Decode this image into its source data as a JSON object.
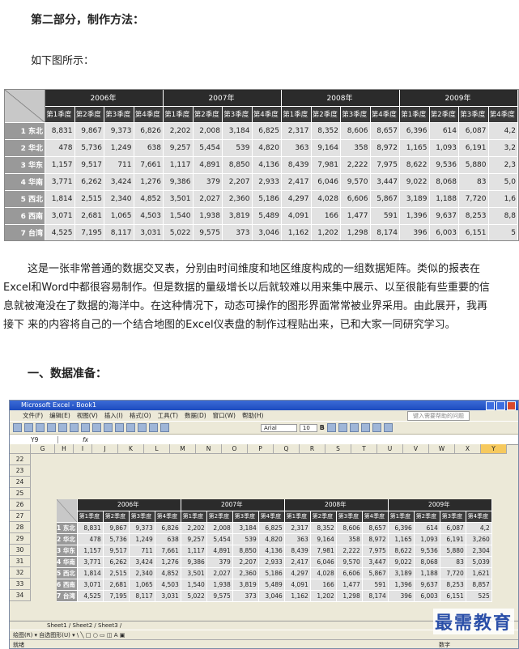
{
  "section_title": "第二部分，制作方法：",
  "intro": "如下图所示：",
  "table": {
    "years": [
      "2006年",
      "2007年",
      "2008年",
      "2009年"
    ],
    "quarters": [
      "第1季度",
      "第2季度",
      "第3季度",
      "第4季度"
    ],
    "rows": [
      {
        "label": "1 东北",
        "values": [
          "8,831",
          "9,867",
          "9,373",
          "6,826",
          "2,202",
          "2,008",
          "3,184",
          "6,825",
          "2,317",
          "8,352",
          "8,606",
          "8,657",
          "6,396",
          "614",
          "6,087",
          "4,2"
        ]
      },
      {
        "label": "2 华北",
        "values": [
          "478",
          "5,736",
          "1,249",
          "638",
          "9,257",
          "5,454",
          "539",
          "4,820",
          "363",
          "9,164",
          "358",
          "8,972",
          "1,165",
          "1,093",
          "6,191",
          "3,2"
        ]
      },
      {
        "label": "3 华东",
        "values": [
          "1,157",
          "9,517",
          "711",
          "7,661",
          "1,117",
          "4,891",
          "8,850",
          "4,136",
          "8,439",
          "7,981",
          "2,222",
          "7,975",
          "8,622",
          "9,536",
          "5,880",
          "2,3"
        ]
      },
      {
        "label": "4 华南",
        "values": [
          "3,771",
          "6,262",
          "3,424",
          "1,276",
          "9,386",
          "379",
          "2,207",
          "2,933",
          "2,417",
          "6,046",
          "9,570",
          "3,447",
          "9,022",
          "8,068",
          "83",
          "5,0"
        ]
      },
      {
        "label": "5 西北",
        "values": [
          "1,814",
          "2,515",
          "2,340",
          "4,852",
          "3,501",
          "2,027",
          "2,360",
          "5,186",
          "4,297",
          "4,028",
          "6,606",
          "5,867",
          "3,189",
          "1,188",
          "7,720",
          "1,6"
        ]
      },
      {
        "label": "6 西南",
        "values": [
          "3,071",
          "2,681",
          "1,065",
          "4,503",
          "1,540",
          "1,938",
          "3,819",
          "5,489",
          "4,091",
          "166",
          "1,477",
          "591",
          "1,396",
          "9,637",
          "8,253",
          "8,8"
        ]
      },
      {
        "label": "7 台湾",
        "values": [
          "4,525",
          "7,195",
          "8,117",
          "3,031",
          "5,022",
          "9,575",
          "373",
          "3,046",
          "1,162",
          "1,202",
          "1,298",
          "8,174",
          "396",
          "6,003",
          "6,151",
          "5"
        ]
      }
    ]
  },
  "paragraph_lines": [
    "这是一张非常普通的数据交叉表，分别由时间维度和地区维度构成的一组数据矩阵。类似的报表在",
    "Excel和Word中都很容易制作。但是数据的量级增长以后就较难以用来集中展示、以至很能有些重要的信",
    "息就被淹没在了数据的海洋中。在这种情况下，动态可操作的图形界面常常被业界采用。由此展开，我再",
    "接下 来的内容将自己的一个结合地图的Excel仪表盘的制作过程贴出来，已和大家一同研究学习。"
  ],
  "section2_title": "一、数据准备：",
  "excel": {
    "title": "Microsoft Excel - Book1",
    "menu": [
      "文件(F)",
      "编辑(E)",
      "视图(V)",
      "插入(I)",
      "格式(O)",
      "工具(T)",
      "数据(D)",
      "窗口(W)",
      "帮助(H)"
    ],
    "help_box": "键入需要帮助的问题",
    "font_name": "Arial",
    "font_size": "10",
    "name_box": "Y9",
    "fx": "fx",
    "columns": [
      "G",
      "H",
      "I",
      "J",
      "K",
      "L",
      "M",
      "N",
      "O",
      "P",
      "Q",
      "R",
      "S",
      "T",
      "U",
      "V",
      "W",
      "X",
      "Y"
    ],
    "row_numbers": [
      "22",
      "23",
      "24",
      "25",
      "26",
      "27",
      "28",
      "29",
      "30",
      "31",
      "32",
      "33",
      "34"
    ],
    "years": [
      "2006年",
      "2007年",
      "2008年",
      "2009年"
    ],
    "quarters": [
      "第1季度",
      "第2季度",
      "第3季度",
      "第4季度"
    ],
    "rows": [
      {
        "label": "1 东北",
        "values": [
          "8,831",
          "9,867",
          "9,373",
          "6,826",
          "2,202",
          "2,008",
          "3,184",
          "6,825",
          "2,317",
          "8,352",
          "8,606",
          "8,657",
          "6,396",
          "614",
          "6,087",
          "4,2"
        ]
      },
      {
        "label": "2 华北",
        "values": [
          "478",
          "5,736",
          "1,249",
          "638",
          "9,257",
          "5,454",
          "539",
          "4,820",
          "363",
          "9,164",
          "358",
          "8,972",
          "1,165",
          "1,093",
          "6,191",
          "3,260"
        ]
      },
      {
        "label": "3 华东",
        "values": [
          "1,157",
          "9,517",
          "711",
          "7,661",
          "1,117",
          "4,891",
          "8,850",
          "4,136",
          "8,439",
          "7,981",
          "2,222",
          "7,975",
          "8,622",
          "9,536",
          "5,880",
          "2,304"
        ]
      },
      {
        "label": "4 华南",
        "values": [
          "3,771",
          "6,262",
          "3,424",
          "1,276",
          "9,386",
          "379",
          "2,207",
          "2,933",
          "2,417",
          "6,046",
          "9,570",
          "3,447",
          "9,022",
          "8,068",
          "83",
          "5,039"
        ]
      },
      {
        "label": "5 西北",
        "values": [
          "1,814",
          "2,515",
          "2,340",
          "4,852",
          "3,501",
          "2,027",
          "2,360",
          "5,186",
          "4,297",
          "4,028",
          "6,606",
          "5,867",
          "3,189",
          "1,188",
          "7,720",
          "1,621"
        ]
      },
      {
        "label": "6 西南",
        "values": [
          "3,071",
          "2,681",
          "1,065",
          "4,503",
          "1,540",
          "1,938",
          "3,819",
          "5,489",
          "4,091",
          "166",
          "1,477",
          "591",
          "1,396",
          "9,637",
          "8,253",
          "8,857"
        ]
      },
      {
        "label": "7 台湾",
        "values": [
          "4,525",
          "7,195",
          "8,117",
          "3,031",
          "5,022",
          "9,575",
          "373",
          "3,046",
          "1,162",
          "1,202",
          "1,298",
          "8,174",
          "396",
          "6,003",
          "6,151",
          "525"
        ]
      }
    ],
    "sheet_tabs": "Sheet1 / Sheet2 / Sheet3 /",
    "drawing_bar": "绘图(R) ▾  自选图形(U) ▾  \\  ╲  □  ○  ▭  ◫  A  ▣",
    "status_left": "就绪",
    "status_right": "数字"
  },
  "watermark": "最需教育"
}
